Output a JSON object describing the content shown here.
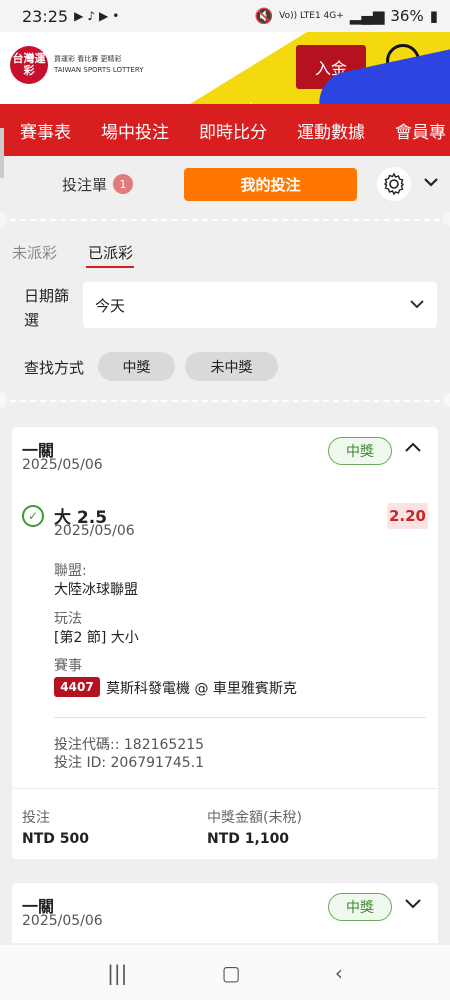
{
  "status": {
    "time": "23:25",
    "icons": [
      "youtube-icon",
      "tiktok-icon",
      "youtube-icon",
      "dot"
    ],
    "signal": "Vo)) LTE1 4G+",
    "battery": "36%"
  },
  "header": {
    "logo": "台灣運彩",
    "logo_tagline_1": "買運彩  看比賽  更精彩",
    "logo_tagline_2": "TAIWAN SPORTS LOTTERY",
    "deposit_label": "入金"
  },
  "nav": {
    "items": [
      "賽事表",
      "場中投注",
      "即時比分",
      "運動數據",
      "會員專"
    ]
  },
  "panel": {
    "slip_label": "投注單",
    "slip_count": "1",
    "my_bets_label": "我的投注"
  },
  "tabs": {
    "unsettled": "未派彩",
    "settled": "已派彩"
  },
  "filter": {
    "date_label": "日期篩選",
    "date_value": "今天",
    "find_label": "查找方式",
    "win_label": "中獎",
    "lose_label": "未中獎"
  },
  "cards": [
    {
      "title": "一關",
      "date": "2025/05/06",
      "status": "中獎",
      "selection": "大 2.5",
      "selection_date": "2025/05/06",
      "odds": "2.20",
      "league_label": "聯盟:",
      "league": "大陸冰球聯盟",
      "market_label": "玩法",
      "market": "[第2 節] 大小",
      "event_label": "賽事",
      "event_no": "4407",
      "event_name": "莫斯科發電機 @ 車里雅賓斯克",
      "bet_code": "投注代碼:: 182165215",
      "bet_id": "投注 ID: 206791745.1",
      "stake_label": "投注",
      "stake": "NTD 500",
      "payout_label": "中獎金額(未稅)",
      "payout": "NTD 1,100"
    },
    {
      "title": "一關",
      "date": "2025/05/06",
      "status": "中獎"
    }
  ],
  "colors": {
    "brand_red": "#d81e1e",
    "orange": "#ff7700",
    "win_green": "#3b8a2e"
  }
}
